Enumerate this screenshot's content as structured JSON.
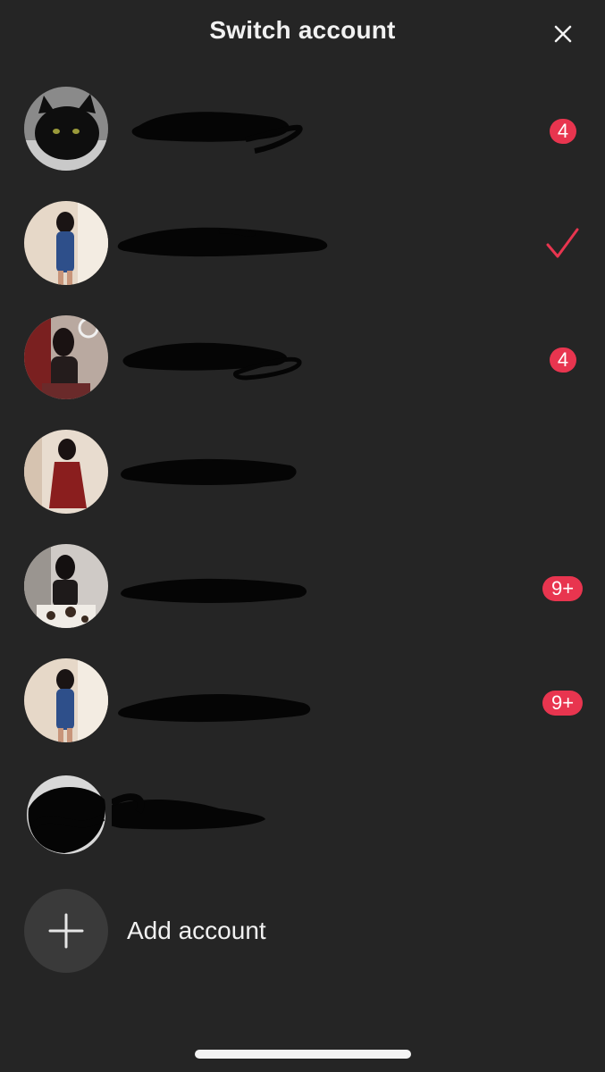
{
  "header": {
    "title": "Switch account",
    "close_icon": "close-icon"
  },
  "accounts": [
    {
      "avatar": "cat-photo",
      "status": "badge",
      "badge": "4"
    },
    {
      "avatar": "person-photo-blue-dress",
      "status": "selected",
      "check_icon": "checkmark-icon"
    },
    {
      "avatar": "person-photo-dark-top",
      "status": "badge",
      "badge": "4"
    },
    {
      "avatar": "person-photo-red-dress",
      "status": "none"
    },
    {
      "avatar": "person-photo-patterned",
      "status": "badge",
      "badge": "9+"
    },
    {
      "avatar": "person-photo-blue-dress",
      "status": "badge",
      "badge": "9+"
    },
    {
      "avatar": "redacted",
      "status": "none"
    }
  ],
  "add_account": {
    "label": "Add account",
    "icon": "plus-icon"
  },
  "colors": {
    "background": "#252525",
    "accent": "#e8354f",
    "text": "#f1f1f1"
  }
}
